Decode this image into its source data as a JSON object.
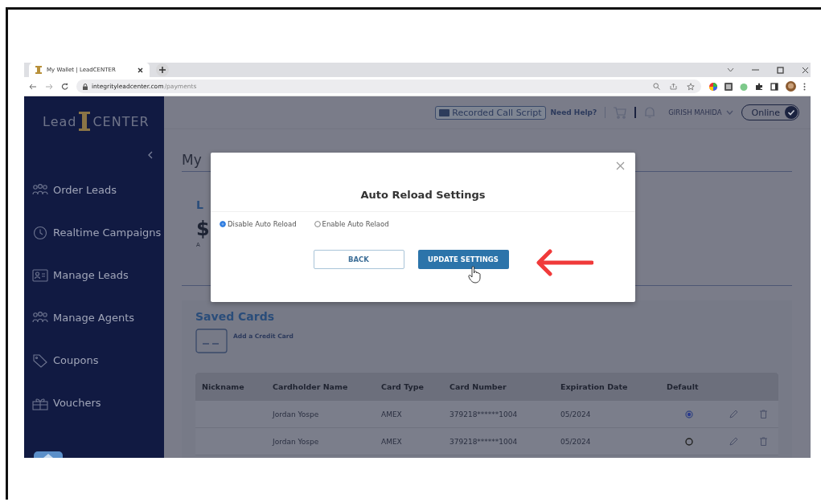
{
  "browser": {
    "tab_title": "My Wallet | LeadCENTER",
    "url_domain": "integrityleadcenter.com",
    "url_path": "/payments"
  },
  "sidebar": {
    "logo_left": "Lead",
    "logo_right": "CENTER",
    "items": [
      {
        "label": "Order Leads",
        "kind": "people"
      },
      {
        "label": "Realtime Campaigns",
        "kind": "clock"
      },
      {
        "label": "Manage Leads",
        "kind": "contact"
      },
      {
        "label": "Manage Agents",
        "kind": "agents"
      },
      {
        "label": "Coupons",
        "kind": "tag"
      },
      {
        "label": "Vouchers",
        "kind": "gift"
      }
    ]
  },
  "header": {
    "script_button": "Recorded Call Script",
    "help": "Need Help?",
    "user": "GIRISH MAHIDA",
    "status": "Online"
  },
  "page": {
    "title": "My",
    "card_heading": "L",
    "balance": "$",
    "balance_note": "A"
  },
  "modal": {
    "title": "Auto Reload Settings",
    "options": [
      {
        "label": "Disable Auto Reload",
        "selected": true
      },
      {
        "label": "Enable Auto Relaod",
        "selected": false
      }
    ],
    "back": "BACK",
    "update": "UPDATE SETTINGS"
  },
  "saved_cards": {
    "title": "Saved Cards",
    "add_label": "Add a Credit Card",
    "columns": [
      "Nickname",
      "Cardholder Name",
      "Card Type",
      "Card Number",
      "Expiration Date",
      "Default"
    ],
    "rows": [
      {
        "cardholder": "Jordan Yospe",
        "type": "AMEX",
        "number": "379218******1004",
        "expiration": "05/2024",
        "default": true
      },
      {
        "cardholder": "Jordan Yospe",
        "type": "AMEX",
        "number": "379218******1004",
        "expiration": "05/2024",
        "default": false
      }
    ]
  }
}
